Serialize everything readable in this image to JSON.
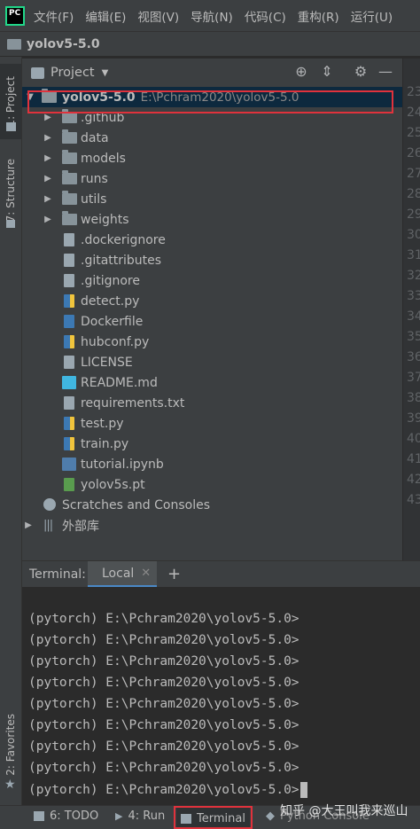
{
  "menubar": {
    "items": [
      "文件(F)",
      "编辑(E)",
      "视图(V)",
      "导航(N)",
      "代码(C)",
      "重构(R)",
      "运行(U)"
    ]
  },
  "navbar": {
    "project_name": "yolov5-5.0"
  },
  "left_stripe": {
    "project_tab": "1: Project",
    "structure_tab": "7: Structure",
    "favorites_tab": "2: Favorites"
  },
  "project_panel": {
    "header_label": "Project",
    "root": {
      "name": "yolov5-5.0",
      "path": "E:\\Pchram2020\\yolov5-5.0"
    },
    "folders": [
      ".github",
      "data",
      "models",
      "runs",
      "utils",
      "weights"
    ],
    "files": [
      ".dockerignore",
      ".gitattributes",
      ".gitignore",
      "detect.py",
      "Dockerfile",
      "hubconf.py",
      "LICENSE",
      "README.md",
      "requirements.txt",
      "test.py",
      "train.py",
      "tutorial.ipynb",
      "yolov5s.pt"
    ],
    "scratches": "Scratches and Consoles",
    "external_libs": "外部库"
  },
  "gutter": {
    "line_numbers": [
      "23",
      "24",
      "25",
      "26",
      "27",
      "28",
      "29",
      "30",
      "31",
      "32",
      "33",
      "34",
      "35",
      "36",
      "37",
      "38",
      "39",
      "40",
      "41",
      "42",
      "43"
    ]
  },
  "terminal": {
    "title": "Terminal:",
    "tab_label": "Local",
    "lines": [
      "(pytorch) E:\\Pchram2020\\yolov5-5.0>",
      "(pytorch) E:\\Pchram2020\\yolov5-5.0>",
      "(pytorch) E:\\Pchram2020\\yolov5-5.0>",
      "(pytorch) E:\\Pchram2020\\yolov5-5.0>",
      "(pytorch) E:\\Pchram2020\\yolov5-5.0>",
      "(pytorch) E:\\Pchram2020\\yolov5-5.0>",
      "(pytorch) E:\\Pchram2020\\yolov5-5.0>",
      "(pytorch) E:\\Pchram2020\\yolov5-5.0>",
      "(pytorch) E:\\Pchram2020\\yolov5-5.0>"
    ]
  },
  "bottom_bar": {
    "todo": "6: TODO",
    "run": "4: Run",
    "terminal": "Terminal",
    "python_console": "Python Console"
  },
  "watermark": "知乎 @大王叫我来巡山",
  "colors": {
    "highlight_red": "#e0323c",
    "selection_blue": "#0d293e",
    "accent_blue": "#4a88c7"
  }
}
